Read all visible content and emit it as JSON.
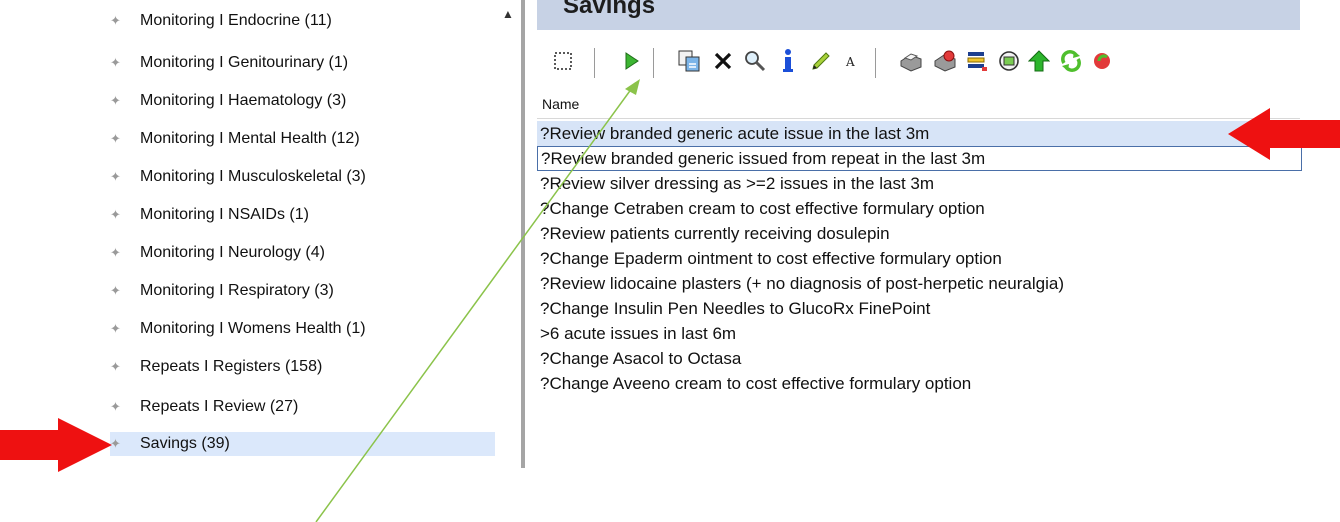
{
  "tree": {
    "items": [
      {
        "label": "Monitoring I Endocrine (11)"
      },
      {
        "label": "Monitoring I Genitourinary (1)"
      },
      {
        "label": "Monitoring I Haematology (3)"
      },
      {
        "label": "Monitoring I Mental Health (12)"
      },
      {
        "label": "Monitoring I Musculoskeletal (3)"
      },
      {
        "label": "Monitoring I NSAIDs (1)"
      },
      {
        "label": "Monitoring I Neurology (4)"
      },
      {
        "label": "Monitoring I Respiratory (3)"
      },
      {
        "label": "Monitoring I Womens Health (1)"
      },
      {
        "label": "Repeats I Registers (158)"
      },
      {
        "label": "Repeats I Review (27)"
      },
      {
        "label": "Savings (39)"
      }
    ],
    "bullet": "✦"
  },
  "pane": {
    "title": "Savings"
  },
  "toolbar": {
    "icons": [
      "select-icon",
      "run-icon",
      "copy-icon",
      "delete-icon",
      "search-icon",
      "info-icon",
      "edit-icon",
      "font-icon",
      "print-icon",
      "export-icon",
      "report-icon",
      "view-icon",
      "up-arrow-icon",
      "refresh-icon",
      "next-icon"
    ]
  },
  "list": {
    "header": "Name",
    "rows": [
      "?Review branded generic acute issue in the last 3m",
      "?Review branded generic issued from repeat in the last 3m",
      "?Review silver dressing as >=2 issues in the last 3m",
      "?Change Cetraben cream to cost effective formulary option",
      "?Review patients currently receiving dosulepin",
      "?Change Epaderm ointment to cost effective formulary option",
      "?Review lidocaine plasters (+ no diagnosis of post-herpetic neuralgia)",
      "?Change Insulin Pen Needles to GlucoRx FinePoint",
      ">6 acute issues in last 6m",
      "?Change Asacol to Octasa",
      "?Change Aveeno cream to cost effective formulary option"
    ]
  },
  "colors": {
    "arrow": "#ee1111",
    "selection": "#dbe8fb",
    "header": "#c7d2e5"
  }
}
